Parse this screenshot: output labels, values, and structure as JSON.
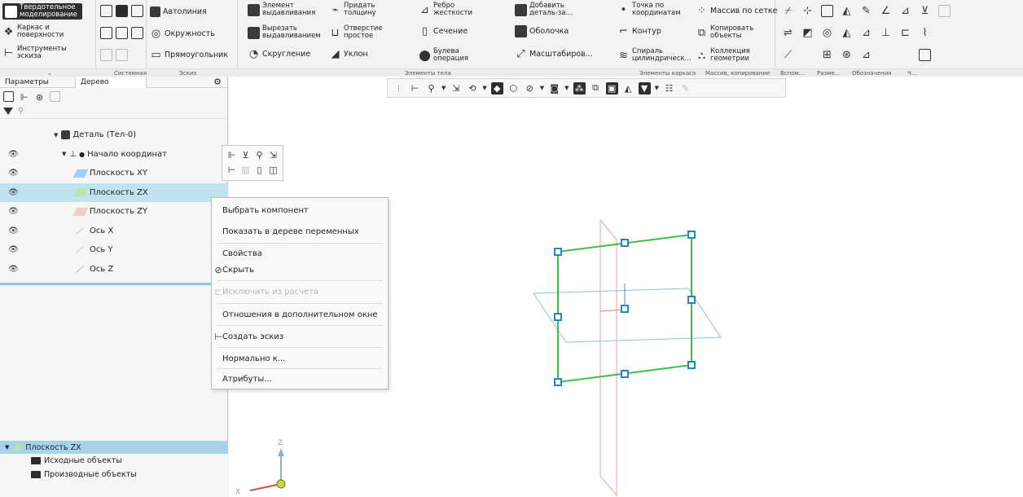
{
  "ribbon": {
    "solid_modeling": "Твердотельное моделирование",
    "frame_surfaces": "Каркас и поверхности",
    "sketch_tools": "Инструменты эскиза",
    "autoline": "Автолиния",
    "circle": "Окружность",
    "rectangle": "Прямоугольник",
    "extrude": "Элемент выдавливания",
    "cut_extrude": "Вырезать выдавливанием",
    "fillet": "Скругление",
    "shell_thicken": "Придать толщину",
    "hole_simple": "Отверстие простое",
    "draft": "Уклон",
    "rib": "Ребро жесткости",
    "section": "Сечение",
    "boolean": "Булева операция",
    "add_part": "Добавить деталь-за...",
    "shell": "Оболочка",
    "scale": "Масштабиров...",
    "point_coords": "Точка по координатам",
    "contour": "Контур",
    "spiral": "Спираль цилиндрическ...",
    "grid_array": "Массив по сетке",
    "copy_objects": "Копировать объекты",
    "geometry_collection": "Коллекция геометрии"
  },
  "group_labels": {
    "system": "Системная",
    "sketch": "Эскиз",
    "body_elements": "Элементы тела",
    "frame_elements": "Элементы каркаса",
    "array_copy": "Массив, копирование",
    "aux": "Вспом...",
    "dims": "Разме...",
    "designations": "Обозначения",
    "ch": "Ч..."
  },
  "panel": {
    "tab_params": "Параметры",
    "tab_tree": "Дерево"
  },
  "tree": {
    "root": "Деталь (Тел-0)",
    "origin": "Начало координат",
    "items": [
      {
        "label": "Плоскость XY",
        "color": "#5aa0f0"
      },
      {
        "label": "Плоскость ZX",
        "color": "#8fd060"
      },
      {
        "label": "Плоскость ZY",
        "color": "#f0a0a0"
      },
      {
        "label": "Ось X",
        "color": "#d9b0b0"
      },
      {
        "label": "Ось Y",
        "color": "#b0d9b0"
      },
      {
        "label": "Ось Z",
        "color": "#a0a0e0"
      }
    ]
  },
  "bottom_panel": {
    "header": "Плоскость ZX",
    "items": [
      "Исходные объекты",
      "Производные объекты"
    ]
  },
  "context_menu": {
    "items": [
      "Выбрать компонент",
      "Показать в дереве переменных",
      "Свойства",
      "Скрыть",
      "Исключить из расчета",
      "Отношения в дополнительном окне",
      "Создать эскиз",
      "Нормально к...",
      "Атрибуты..."
    ]
  },
  "triad": {
    "z": "Z",
    "x": "X"
  },
  "colors": {
    "selection": "#bfe3ef",
    "plane_highlight": "#3fbf3f",
    "handle": "#1e88c8",
    "plane_xy": "#8cc0d8",
    "plane_zy": "#e8a0a0"
  }
}
